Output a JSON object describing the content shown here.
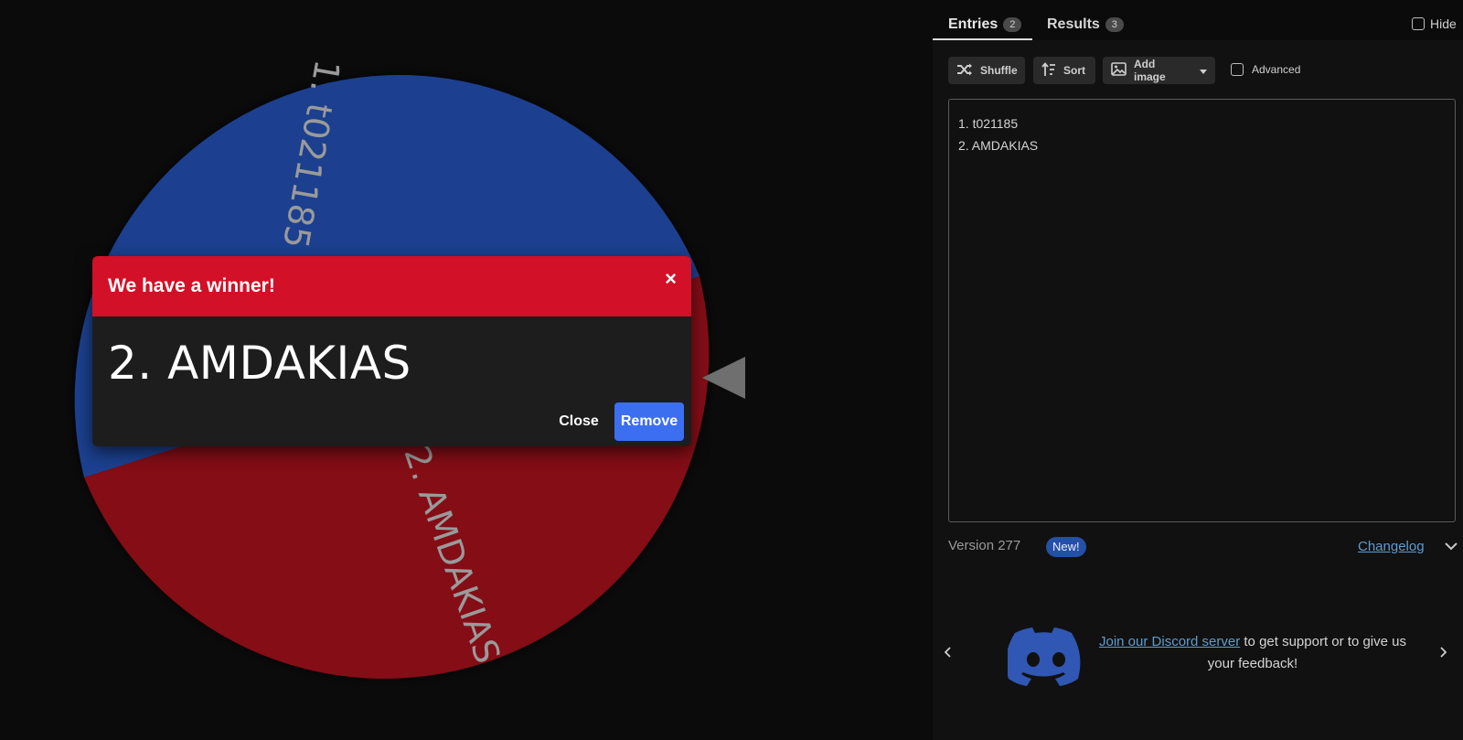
{
  "wheel": {
    "segments": [
      {
        "label": "1. t021185",
        "color": "#1f3f8f"
      },
      {
        "label": "2. AMDAKIAS",
        "color": "#840b16"
      }
    ],
    "pointer_color": "#6f6f6f"
  },
  "dialog": {
    "title": "We have a winner!",
    "close_x": "×",
    "winner": "2. AMDAKIAS",
    "close_label": "Close",
    "remove_label": "Remove"
  },
  "tabs": {
    "entries_label": "Entries",
    "entries_count": "2",
    "results_label": "Results",
    "results_count": "3",
    "hide_label": "Hide"
  },
  "toolbar": {
    "shuffle_label": "Shuffle",
    "sort_label": "Sort",
    "add_image_label": "Add image",
    "advanced_label": "Advanced"
  },
  "entries": [
    "1. t021185",
    "2. AMDAKIAS"
  ],
  "footer": {
    "version": "Version 277",
    "new_badge": "New!",
    "changelog": "Changelog"
  },
  "discord": {
    "link_text": "Join our Discord server",
    "rest_text": " to get support or to give us your feedback!"
  }
}
